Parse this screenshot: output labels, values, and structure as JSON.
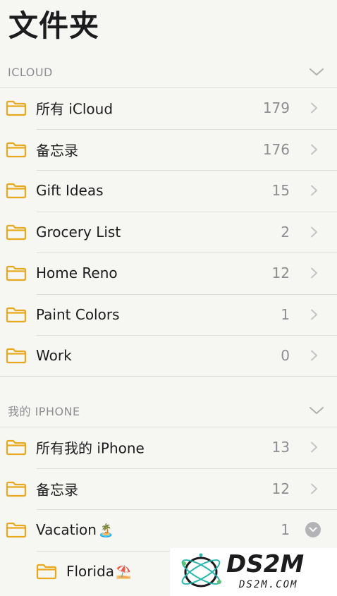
{
  "header": {
    "title": "文件夹"
  },
  "sections": [
    {
      "title": "ICLOUD",
      "folders": [
        {
          "name": "所有 iCloud",
          "count": "179"
        },
        {
          "name": "备忘录",
          "count": "176"
        },
        {
          "name": "Gift Ideas",
          "count": "15"
        },
        {
          "name": "Grocery List",
          "count": "2"
        },
        {
          "name": "Home Reno",
          "count": "12"
        },
        {
          "name": "Paint Colors",
          "count": "1"
        },
        {
          "name": "Work",
          "count": "0"
        }
      ]
    },
    {
      "title": "我的 IPHONE",
      "folders": [
        {
          "name": "所有我的 iPhone",
          "count": "13"
        },
        {
          "name": "备忘录",
          "count": "12"
        },
        {
          "name": "Vacation",
          "emoji": "🏝️",
          "count": "1",
          "expanded": true
        },
        {
          "name": "Florida",
          "emoji": "⛱️",
          "subfolder": true
        }
      ]
    }
  ],
  "watermark": {
    "brand": "DS2M",
    "site": "DS2M.COM"
  },
  "colors": {
    "accent": "#E8A91E",
    "secondary": "#8E8E93",
    "separator": "#DCDCD8"
  }
}
